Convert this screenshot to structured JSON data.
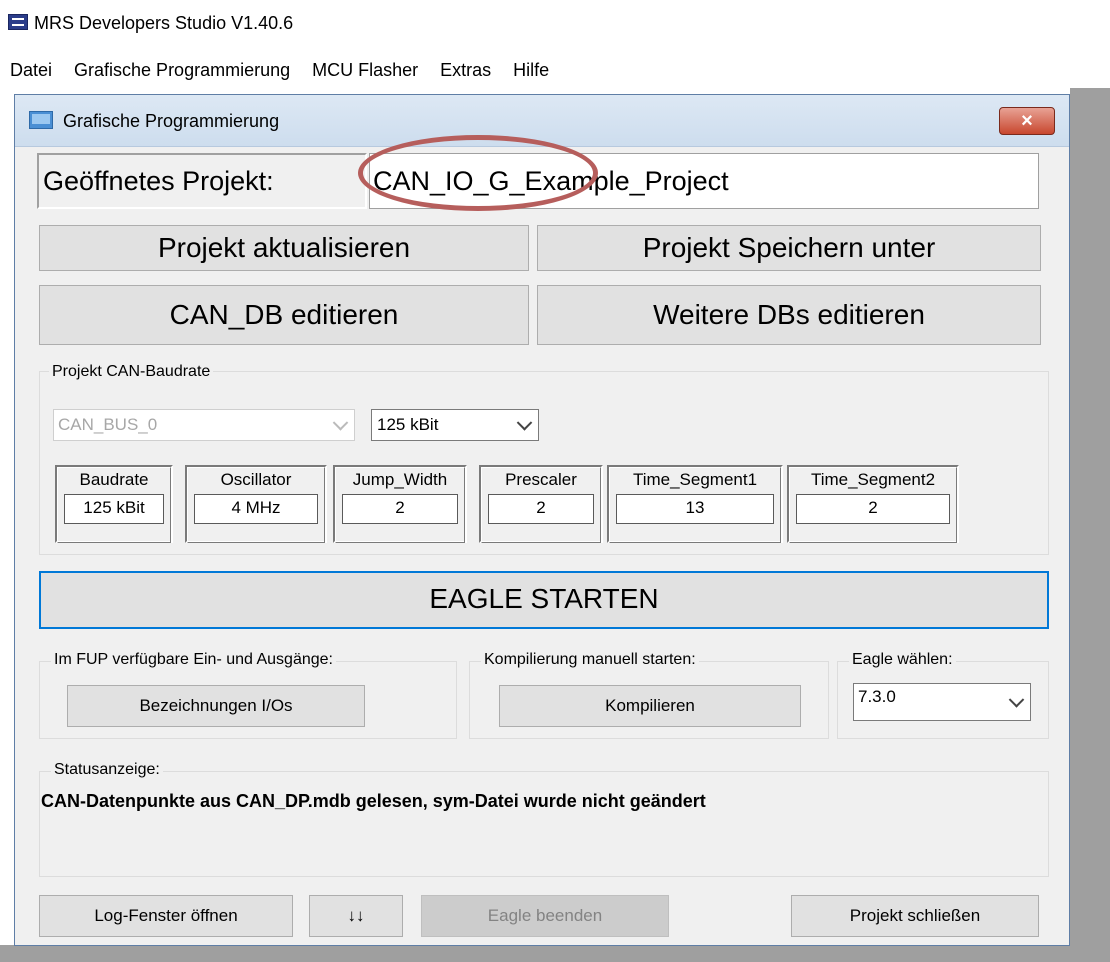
{
  "app": {
    "title": "MRS Developers Studio V1.40.6",
    "menu": [
      "Datei",
      "Grafische Programmierung",
      "MCU Flasher",
      "Extras",
      "Hilfe"
    ]
  },
  "dialog": {
    "title": "Grafische Programmierung",
    "close_glyph": "×",
    "project_label": "Geöffnetes Projekt:",
    "project_name": "CAN_IO_G_Example_Project",
    "buttons": {
      "update": "Projekt aktualisieren",
      "save_as": "Projekt Speichern unter",
      "edit_can_db": "CAN_DB editieren",
      "edit_other_dbs": "Weitere DBs editieren"
    },
    "baudrate_group": {
      "label": "Projekt CAN-Baudrate",
      "bus_select": "CAN_BUS_0",
      "baud_select": "125 kBit",
      "params": [
        {
          "header": "Baudrate",
          "value": "125 kBit"
        },
        {
          "header": "Oscillator",
          "value": "4 MHz"
        },
        {
          "header": "Jump_Width",
          "value": "2"
        },
        {
          "header": "Prescaler",
          "value": "2"
        },
        {
          "header": "Time_Segment1",
          "value": "13"
        },
        {
          "header": "Time_Segment2",
          "value": "2"
        }
      ]
    },
    "eagle_start": "EAGLE STARTEN",
    "io_group": {
      "label": "Im FUP verfügbare Ein- und Ausgänge:",
      "button": "Bezeichnungen I/Os"
    },
    "compile_group": {
      "label": "Kompilierung manuell starten:",
      "button": "Kompilieren"
    },
    "eagle_group": {
      "label": "Eagle wählen:",
      "select": "7.3.0"
    },
    "status_group": {
      "label": "Statusanzeige:",
      "text": "CAN-Datenpunkte aus CAN_DP.mdb gelesen, sym-Datei wurde nicht geändert"
    },
    "footer": {
      "log": "Log-Fenster öffnen",
      "arrows": "↓↓",
      "eagle_quit": "Eagle beenden",
      "close_project": "Projekt schließen"
    }
  },
  "colors": {
    "highlight_ellipse": "#b65e5c",
    "focus_border": "#0078d7",
    "close_button": "#c8472e"
  }
}
